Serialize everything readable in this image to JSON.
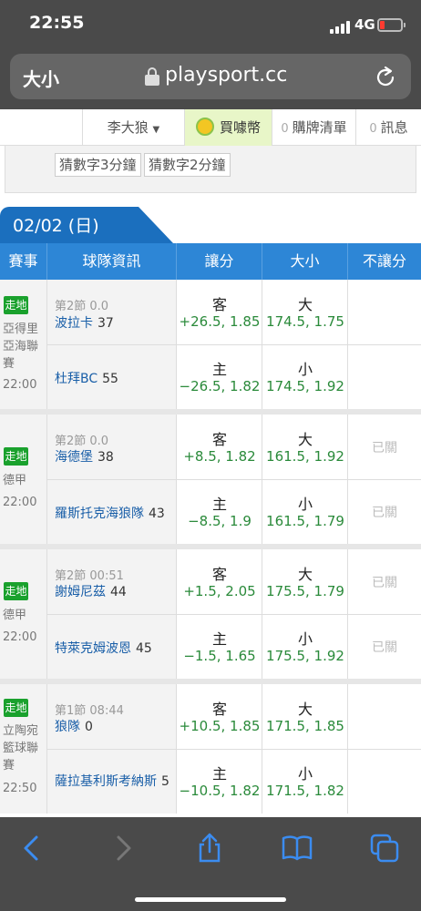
{
  "status": {
    "time": "22:55",
    "network": "4G"
  },
  "browser": {
    "text_size": "大小",
    "url": "playsport.cc"
  },
  "topnav": {
    "user": "李大狼",
    "buy_coins": "買噱幣",
    "cart": {
      "count": "0",
      "label": "購牌清單"
    },
    "messages": {
      "count": "0",
      "label": "訊息"
    }
  },
  "guess_chips": [
    "猜數字3分鐘",
    "猜數字2分鐘"
  ],
  "date_label": "02/02 (日)",
  "headers": [
    "賽事",
    "球隊資訊",
    "讓分",
    "大小",
    "不讓分"
  ],
  "games": [
    {
      "badge": "走地",
      "league": "亞得里亞海聯賽",
      "time": "22:00",
      "period": "第2節 0.0",
      "away": {
        "name": "波拉卡",
        "score": "37"
      },
      "home": {
        "name": "杜拜BC",
        "score": "55"
      },
      "spread": {
        "away_label": "客",
        "away_value": "+26.5, 1.85",
        "home_label": "主",
        "home_value": "−26.5, 1.82"
      },
      "total": {
        "over_label": "大",
        "over_value": "174.5, 1.75",
        "under_label": "小",
        "under_value": "174.5, 1.92"
      },
      "moneyline": {
        "away": "",
        "home": ""
      }
    },
    {
      "badge": "走地",
      "league": "德甲",
      "time": "22:00",
      "period": "第2節 0.0",
      "away": {
        "name": "海德堡",
        "score": "38"
      },
      "home": {
        "name": "羅斯托克海狼隊",
        "score": "43"
      },
      "spread": {
        "away_label": "客",
        "away_value": "+8.5, 1.82",
        "home_label": "主",
        "home_value": "−8.5, 1.9"
      },
      "total": {
        "over_label": "大",
        "over_value": "161.5, 1.92",
        "under_label": "小",
        "under_value": "161.5, 1.79"
      },
      "moneyline": {
        "away": "已關",
        "home": "已關"
      }
    },
    {
      "badge": "走地",
      "league": "德甲",
      "time": "22:00",
      "period": "第2節 00:51",
      "away": {
        "name": "謝姆尼茲",
        "score": "44"
      },
      "home": {
        "name": "特萊克姆波恩",
        "score": "45"
      },
      "spread": {
        "away_label": "客",
        "away_value": "+1.5, 2.05",
        "home_label": "主",
        "home_value": "−1.5, 1.65"
      },
      "total": {
        "over_label": "大",
        "over_value": "175.5, 1.79",
        "under_label": "小",
        "under_value": "175.5, 1.92"
      },
      "moneyline": {
        "away": "已關",
        "home": "已關"
      }
    },
    {
      "badge": "走地",
      "league": "立陶宛籃球聯賽",
      "time": "22:50",
      "period": "第1節 08:44",
      "away": {
        "name": "狼隊",
        "score": "0"
      },
      "home": {
        "name": "薩拉基利斯考納斯",
        "score": "5"
      },
      "spread": {
        "away_label": "客",
        "away_value": "+10.5, 1.85",
        "home_label": "主",
        "home_value": "−10.5, 1.82"
      },
      "total": {
        "over_label": "大",
        "over_value": "171.5, 1.85",
        "under_label": "小",
        "under_value": "171.5, 1.82"
      },
      "moneyline": {
        "away": "",
        "home": ""
      }
    }
  ]
}
